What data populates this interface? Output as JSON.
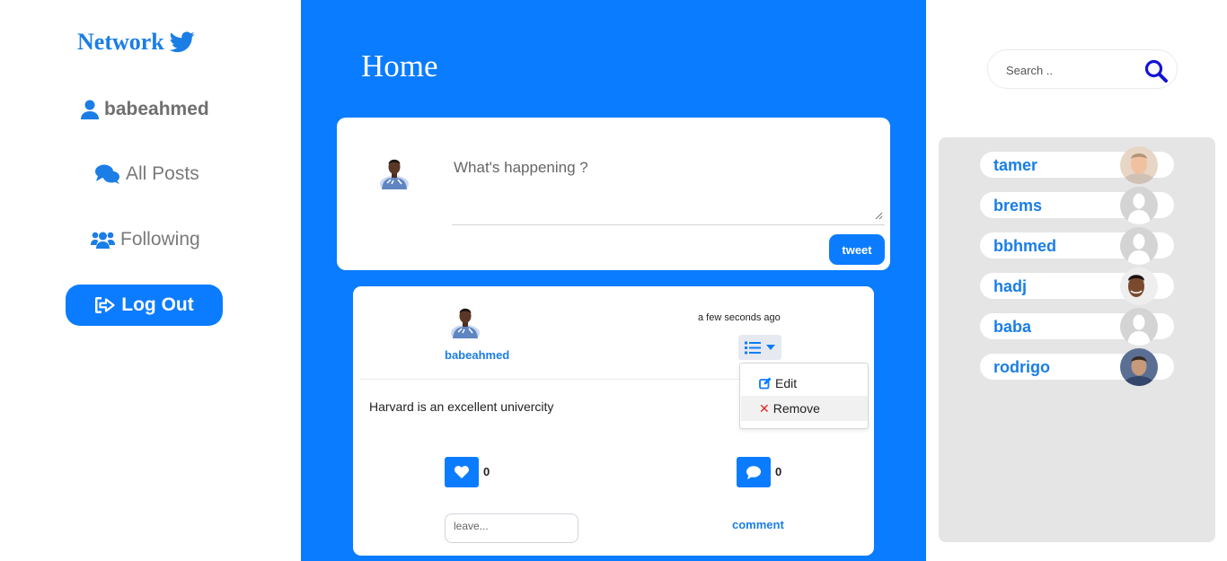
{
  "brand": {
    "name": "Network"
  },
  "sidebar": {
    "username": "babeahmed",
    "all_posts": "All Posts",
    "following": "Following",
    "logout": "Log Out"
  },
  "main": {
    "title": "Home",
    "compose": {
      "placeholder": "What's happening ?",
      "tweet_label": "tweet"
    },
    "post": {
      "author": "babeahmed",
      "time": "a few seconds ago",
      "text": "Harvard is an excellent univercity",
      "menu": {
        "edit": "Edit",
        "remove": "Remove"
      },
      "likes": "0",
      "comments": "0",
      "comment_placeholder": "leave...",
      "comment_label": "comment"
    }
  },
  "search": {
    "placeholder": "Search .."
  },
  "users": [
    {
      "name": "tamer",
      "avatar": "photo-light"
    },
    {
      "name": "brems",
      "avatar": "default-silhouette"
    },
    {
      "name": "bbhmed",
      "avatar": "default-silhouette"
    },
    {
      "name": "hadj",
      "avatar": "photo-dark"
    },
    {
      "name": "baba",
      "avatar": "default-silhouette"
    },
    {
      "name": "rodrigo",
      "avatar": "photo-blue"
    }
  ],
  "colors": {
    "accent": "#0b7cff",
    "link": "#1a7ee6",
    "panel": "#e5e5e5",
    "danger": "#e52222",
    "search_icon": "#1414d6"
  }
}
